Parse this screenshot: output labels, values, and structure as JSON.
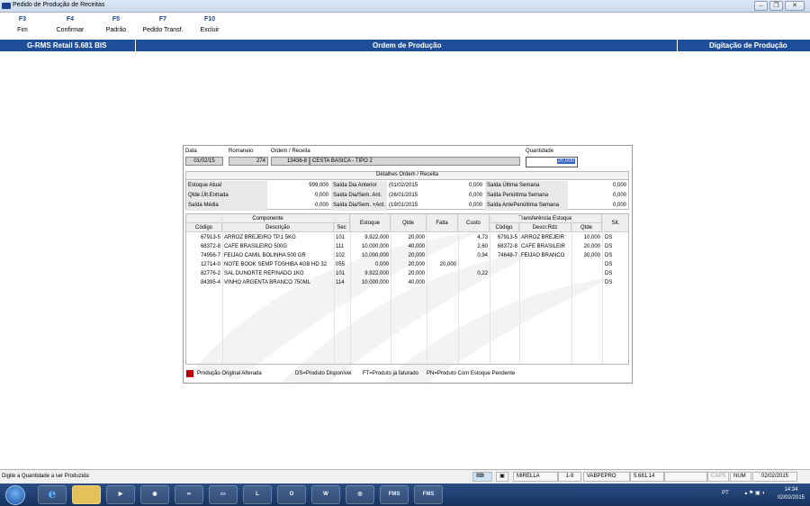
{
  "window": {
    "title": "Pedido de Produção de Receitas"
  },
  "fkeys": [
    {
      "key": "F3",
      "label": "Fim"
    },
    {
      "key": "F4",
      "label": "Confirmar"
    },
    {
      "key": "F5",
      "label": "Padrão"
    },
    {
      "key": "F7",
      "label": "Pedido Transf."
    },
    {
      "key": "F10",
      "label": "Excluir"
    }
  ],
  "banner": {
    "left": "G-RMS Retail 5.681 BIS",
    "center": "Ordem de Produção",
    "right": "Digitação de Produção"
  },
  "header": {
    "data_label": "Data",
    "data_value": "01/02/15",
    "romaneio_label": "Romaneio",
    "romaneio_value": "274",
    "ordem_label": "Ordem / Receita",
    "ordem_code": "13436-8",
    "ordem_desc": "CESTA BASICA - TIPO 2",
    "quantidade_label": "Quantidade",
    "quantidade_value": "20,000"
  },
  "details": {
    "caption": "Detalhes Ordem / Receita",
    "rows": [
      [
        {
          "l": "Estoque Atual",
          "v": "999,000"
        },
        {
          "l": "Saída Dia Anterior",
          "d": "(01/02/2015",
          "v": "0,000"
        },
        {
          "l": "Saída Última Semana",
          "v": "0,000"
        }
      ],
      [
        {
          "l": "Qtde.Últ.Entrada",
          "v": "0,000"
        },
        {
          "l": "Saída Dia/Sem. Ant.",
          "d": "(26/01/2015",
          "v": "0,000"
        },
        {
          "l": "Saída Penúltima Semana",
          "v": "0,000"
        }
      ],
      [
        {
          "l": "Saída Média",
          "v": "0,000"
        },
        {
          "l": "Saída Dia/Sem. +Ant.",
          "d": "(19/01/2015",
          "v": "0,000"
        },
        {
          "l": "Saída AntePenúltima Semana",
          "v": "0,000"
        }
      ]
    ]
  },
  "grid": {
    "headers": {
      "componente": "Componente",
      "codigo": "Código",
      "descricao": "Descrição",
      "sec": "Sec",
      "estoque": "Estoque",
      "qtde": "Qtde",
      "falta": "Falta",
      "custo": "Custo",
      "transferencia": "Transferência Estoque",
      "t_codigo": "Código",
      "t_descr": "Descr.Rdz",
      "t_qtde": "Qtde",
      "sit": "Sit."
    },
    "rows": [
      {
        "codigo": "67913-5",
        "descricao": "ARROZ BREJEIRO TP.1 5KG",
        "sec": "101",
        "estoque": "9.922,000",
        "qtde": "20,000",
        "falta": "",
        "custo": "4,73",
        "t_codigo": "67913-5",
        "t_descr": "ARROZ BREJEIR",
        "t_qtde": "10,000",
        "sit": "DS"
      },
      {
        "codigo": "68372-8",
        "descricao": "CAFE BRASILEIRO 500G",
        "sec": "111",
        "estoque": "10.000,000",
        "qtde": "40,000",
        "falta": "",
        "custo": "2,60",
        "t_codigo": "68372-8",
        "t_descr": "CAFE BRASILEIR",
        "t_qtde": "20,000",
        "sit": "DS"
      },
      {
        "codigo": "74956-7",
        "descricao": "FEIJAO CAMIL BOLINHA 500 GR",
        "sec": "102",
        "estoque": "10.000,000",
        "qtde": "20,000",
        "falta": "",
        "custo": "0,94",
        "t_codigo": "74648-7",
        "t_descr": "FEIJAO BRANCO",
        "t_qtde": "30,000",
        "sit": "DS"
      },
      {
        "codigo": "12714-0",
        "descricao": "NOTE BOOK SEMP TOSHIBA 4GB HD 32",
        "sec": "055",
        "estoque": "0,000",
        "qtde": "20,000",
        "falta": "20,000",
        "custo": "",
        "t_codigo": "",
        "t_descr": "",
        "t_qtde": "",
        "sit": "DS"
      },
      {
        "codigo": "82776-2",
        "descricao": "SAL DUNORTE REFINADO 1KG",
        "sec": "101",
        "estoque": "9.922,000",
        "qtde": "20,000",
        "falta": "",
        "custo": "0,22",
        "t_codigo": "",
        "t_descr": "",
        "t_qtde": "",
        "sit": "DS"
      },
      {
        "codigo": "84395-4",
        "descricao": "VINHO ARGENTA BRANCO 750ML",
        "sec": "114",
        "estoque": "10.000,000",
        "qtde": "40,000",
        "falta": "",
        "custo": "",
        "t_codigo": "",
        "t_descr": "",
        "t_qtde": "",
        "sit": "DS"
      }
    ]
  },
  "legend": {
    "altered": "Produção Original Alterada",
    "ds": "DS=Produto Disponível",
    "ft": "FT=Produto já faturado",
    "pn": "PN=Produto Com Estoque Pendente"
  },
  "statusbar": {
    "message": "Digite a Quantidade a ser Produzida",
    "user": "MIRELLA",
    "store": "1-9",
    "host": "VABPEPRO",
    "version": "5.681.14",
    "caps": "CAPS",
    "num": "NUM",
    "date": "02/02/2015"
  },
  "taskbar": {
    "fms1": "FMS",
    "fms2": "FMS",
    "lang": "PT",
    "time": "14:34",
    "date": "02/02/2015"
  },
  "colors": {
    "banner": "#1f4f9a",
    "altered_marker": "#c00000",
    "selection": "#3163c6"
  }
}
